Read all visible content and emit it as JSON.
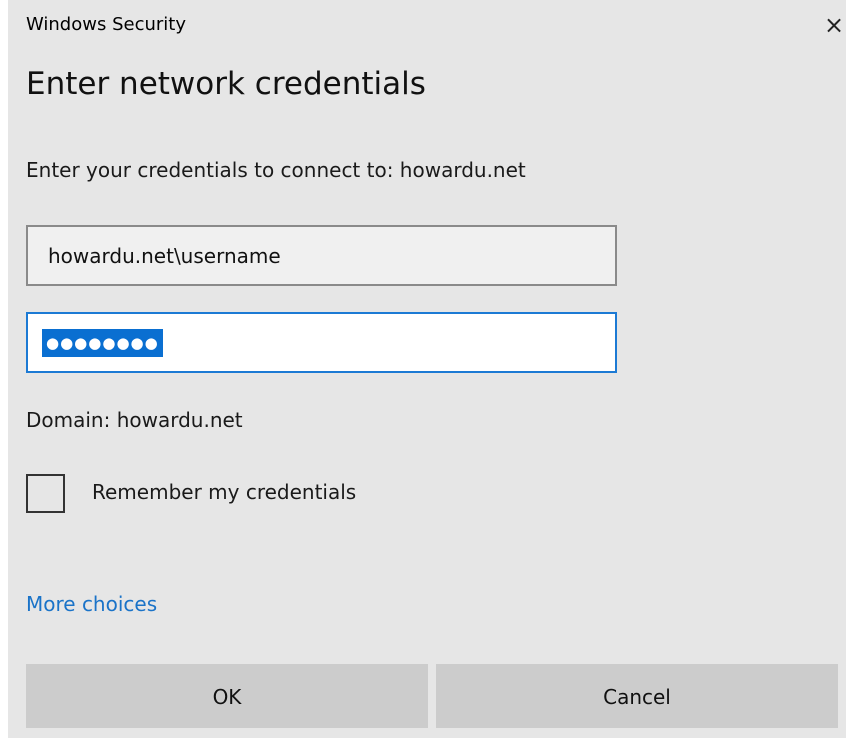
{
  "window": {
    "title": "Windows Security",
    "close_glyph": "×"
  },
  "dialog": {
    "heading": "Enter network credentials",
    "subtext": "Enter your credentials to connect to: howardu.net"
  },
  "form": {
    "username_value": "howardu.net\\username",
    "password_masked": "●●●●●●●●",
    "domain_text": "Domain: howardu.net",
    "remember_label": "Remember my credentials",
    "remember_checked": false
  },
  "links": {
    "more_choices": "More choices"
  },
  "buttons": {
    "ok": "OK",
    "cancel": "Cancel"
  },
  "colors": {
    "background": "#e6e6e6",
    "accent": "#0a6fd1",
    "link": "#1a73c8",
    "button": "#cccccc"
  },
  "icons": {
    "close": "close-icon",
    "checkbox": "checkbox-unchecked-icon"
  }
}
